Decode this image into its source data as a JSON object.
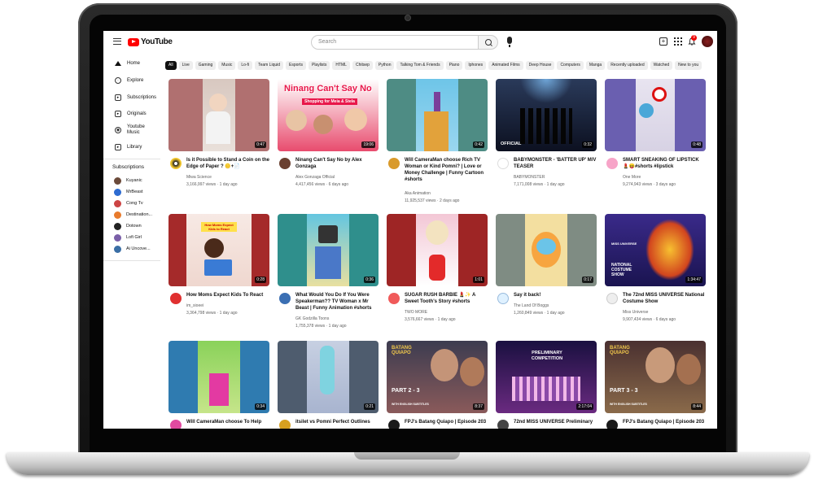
{
  "header": {
    "logo_text": "YouTube",
    "search_placeholder": "Search",
    "notification_count": "9"
  },
  "sidebar": {
    "items": [
      {
        "label": "Home",
        "icon": "home-icon"
      },
      {
        "label": "Explore",
        "icon": "compass-icon"
      },
      {
        "label": "Subscriptions",
        "icon": "subscriptions-icon"
      },
      {
        "label": "Originals",
        "icon": "originals-icon"
      },
      {
        "label": "Youtube Music",
        "icon": "music-icon"
      },
      {
        "label": "Library",
        "icon": "library-icon"
      }
    ],
    "subscriptions_heading": "Subscriptions",
    "subscriptions": [
      {
        "name": "Kuyanic",
        "color": "#6b4a3a"
      },
      {
        "name": "MrBeast",
        "color": "#2d6bd1"
      },
      {
        "name": "Cong Tv",
        "color": "#c44"
      },
      {
        "name": "Destination...",
        "color": "#e87b2d"
      },
      {
        "name": "Dotown",
        "color": "#222"
      },
      {
        "name": "Lofi Girl",
        "color": "#7a5fa8"
      },
      {
        "name": "Ai Uncove...",
        "color": "#3a6ea5"
      }
    ]
  },
  "chips": [
    "All",
    "Live",
    "Gaming",
    "Music",
    "Lo-fi",
    "Team Liquid",
    "Esports",
    "Playlists",
    "HTML",
    "Chitsep",
    "Python",
    "Talking Tom & Friends",
    "Piano",
    "Iphones",
    "Animated Films",
    "Deep House",
    "Computers",
    "Manga",
    "Recently uploaded",
    "Watched",
    "New to you"
  ],
  "videos": [
    {
      "title": "Is it Possible to Stand a Coin on the Edge of Paper ? 🪙+📄",
      "channel": "Miwa Science",
      "meta": "3,166,997 views · 1 day ago",
      "duration": "0:47"
    },
    {
      "title": "Ninang Can't Say No by Alex Gonzaga",
      "channel": "Alex Gonzaga Official",
      "meta": "4,417,456 views · 6 days ago",
      "duration": "19:06"
    },
    {
      "title": "Will CameraMan choose Rich TV Woman or Kind Pomni? | Love or Money Challenge | Funny Cartoon #shorts",
      "channel": "Aka Animation",
      "meta": "11,925,537 views · 2 days ago",
      "duration": "0:42"
    },
    {
      "title": "BABYMONSTER - 'BATTER UP' M/V TEASER",
      "channel": "BABYMONSTER",
      "meta": "7,171,008 views · 1 day ago",
      "duration": "0:32"
    },
    {
      "title": "SMART SNEAKING OF LIPSTICK 💄😝#shorts #lipstick",
      "channel": "One More",
      "meta": "9,274,943 views · 3 days ago",
      "duration": "0:48"
    },
    {
      "title": "How Moms Expect Kids To React",
      "channel": "im_sioeei",
      "meta": "3,364,798 views · 1 day ago",
      "duration": "0:28"
    },
    {
      "title": "What Would You Do If You Were Speakerman?? TV Woman x Mr Beast | Funny Animation #shorts",
      "channel": "GK Godzilla Toons",
      "meta": "1,755,378 views · 1 day ago",
      "duration": "0:36"
    },
    {
      "title": "SUGAR RUSH BARBIE 💄✨ A Sweet Tooth's Story #shorts",
      "channel": "TWO MORE",
      "meta": "3,576,667 views · 1 day ago",
      "duration": "1:01"
    },
    {
      "title": "Say it back!",
      "channel": "The Land Of Boggs",
      "meta": "1,260,849 views · 1 day ago",
      "duration": "0:17"
    },
    {
      "title": "The 72nd MISS UNIVERSE National Costume Show",
      "channel": "Miss Universe",
      "meta": "9,907,434 views · 6 days ago",
      "duration": "1:34:47"
    },
    {
      "title": "Will CameraMan choose To Help",
      "channel": "",
      "meta": "",
      "duration": "0:34"
    },
    {
      "title": "itsilet vs Pomni Perfect Outlines",
      "channel": "",
      "meta": "",
      "duration": "0:21"
    },
    {
      "title": "FPJ's Batang Quiapo | Episode 203",
      "channel": "",
      "meta": "",
      "duration": "8:37"
    },
    {
      "title": "72nd MISS UNIVERSE Preliminary",
      "channel": "",
      "meta": "",
      "duration": "2:17:04"
    },
    {
      "title": "FPJ's Batang Quiapo | Episode 203",
      "channel": "",
      "meta": "",
      "duration": "8:44"
    }
  ],
  "thumb_text": {
    "ninang_title": "Ninang Can't Say No",
    "ninang_sub": "Shopping for Meia & Stela",
    "official": "OFFICIAL",
    "moms_card": "How Moms Expect Kids to React",
    "miss_universe_brand": "MISS UNIVERSE",
    "costume_show": "NATIONAL COSTUME SHOW",
    "batang_quiapo": "BATANG QUIAPO",
    "part_a": "PART 2 - 3",
    "part_b": "PART 3 - 3",
    "prelim": "PRELIMINARY COMPETITION",
    "with_subtitles": "WITH ENGLISH SUBTITLES"
  }
}
